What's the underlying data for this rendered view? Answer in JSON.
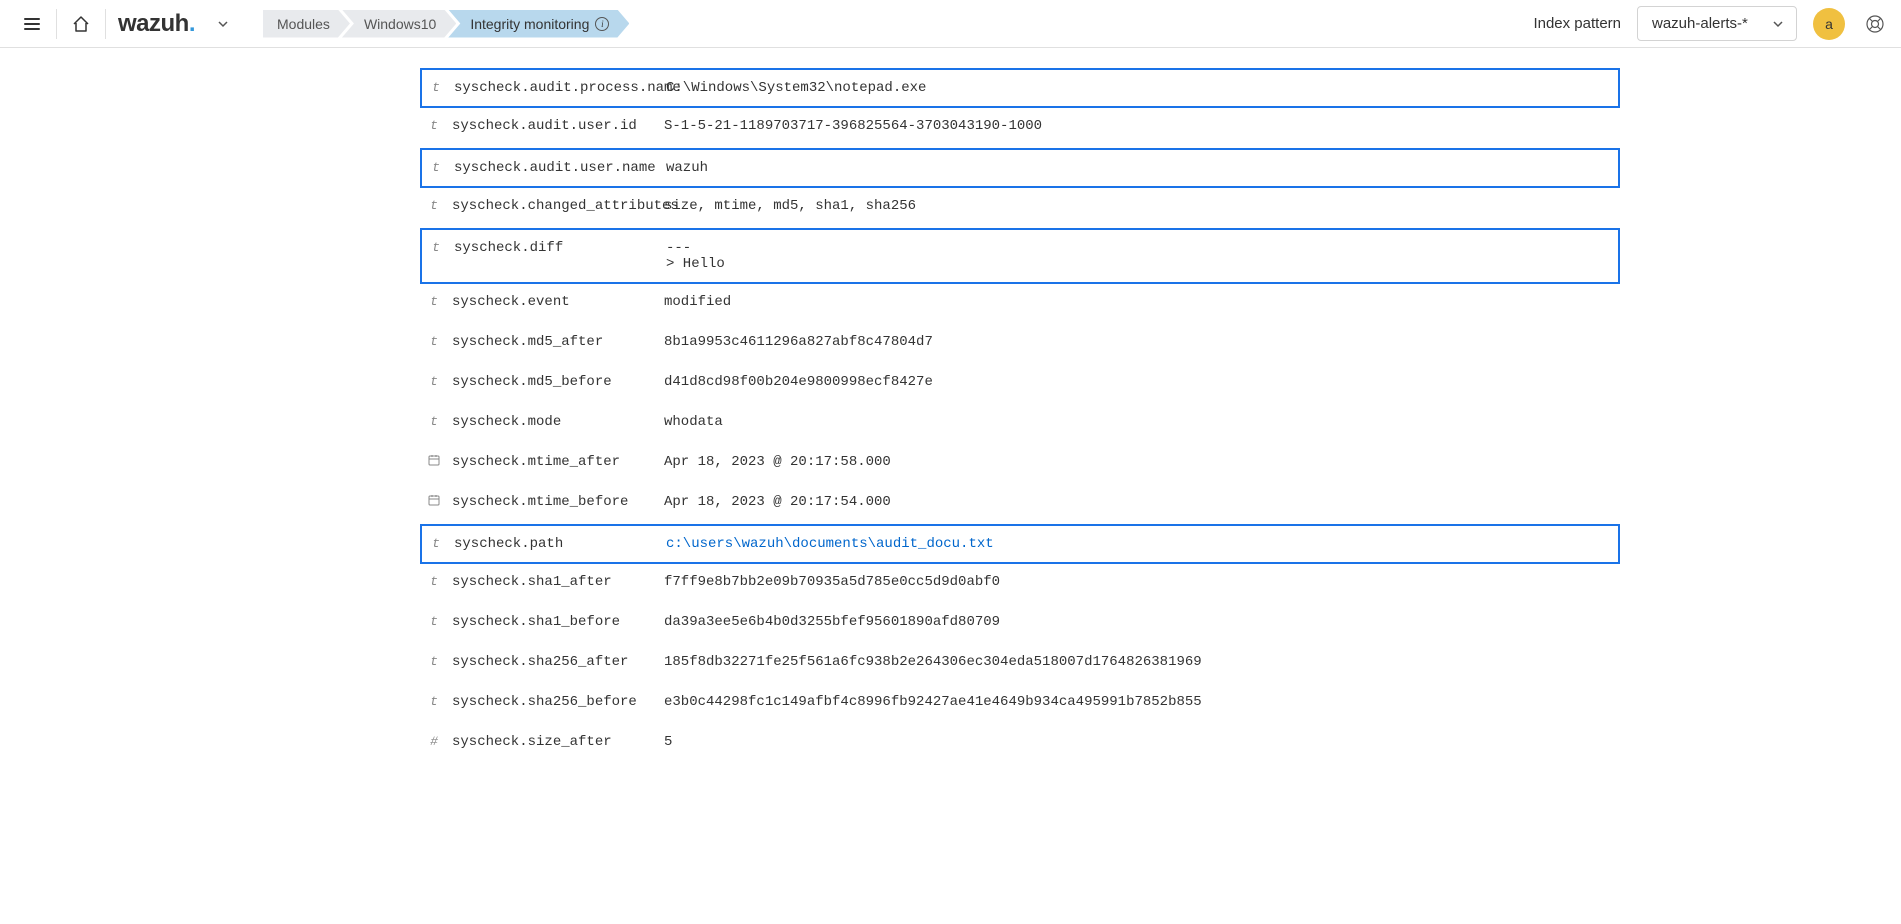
{
  "header": {
    "logo": "wazuh",
    "breadcrumbs": [
      {
        "label": "Modules"
      },
      {
        "label": "Windows10"
      },
      {
        "label": "Integrity monitoring"
      }
    ],
    "indexPatternLabel": "Index pattern",
    "indexPatternValue": "wazuh-alerts-*",
    "avatarLetter": "a"
  },
  "fields": [
    {
      "type": "t",
      "name": "syscheck.audit.process.name",
      "value": "C:\\Windows\\System32\\notepad.exe",
      "highlighted": true
    },
    {
      "type": "t",
      "name": "syscheck.audit.user.id",
      "value": "S-1-5-21-1189703717-396825564-3703043190-1000"
    },
    {
      "type": "t",
      "name": "syscheck.audit.user.name",
      "value": "wazuh",
      "highlighted": true
    },
    {
      "type": "t",
      "name": "syscheck.changed_attributes",
      "value": "size, mtime, md5, sha1, sha256"
    },
    {
      "type": "t",
      "name": "syscheck.diff",
      "value": "---\n> Hello",
      "highlighted": true
    },
    {
      "type": "t",
      "name": "syscheck.event",
      "value": "modified"
    },
    {
      "type": "t",
      "name": "syscheck.md5_after",
      "value": "8b1a9953c4611296a827abf8c47804d7"
    },
    {
      "type": "t",
      "name": "syscheck.md5_before",
      "value": "d41d8cd98f00b204e9800998ecf8427e"
    },
    {
      "type": "t",
      "name": "syscheck.mode",
      "value": "whodata"
    },
    {
      "type": "date",
      "name": "syscheck.mtime_after",
      "value": "Apr 18, 2023 @ 20:17:58.000"
    },
    {
      "type": "date",
      "name": "syscheck.mtime_before",
      "value": "Apr 18, 2023 @ 20:17:54.000"
    },
    {
      "type": "t",
      "name": "syscheck.path",
      "value": "c:\\users\\wazuh\\documents\\audit_docu.txt",
      "highlighted": true,
      "link": true
    },
    {
      "type": "t",
      "name": "syscheck.sha1_after",
      "value": "f7ff9e8b7bb2e09b70935a5d785e0cc5d9d0abf0"
    },
    {
      "type": "t",
      "name": "syscheck.sha1_before",
      "value": "da39a3ee5e6b4b0d3255bfef95601890afd80709"
    },
    {
      "type": "t",
      "name": "syscheck.sha256_after",
      "value": "185f8db32271fe25f561a6fc938b2e264306ec304eda518007d1764826381969"
    },
    {
      "type": "t",
      "name": "syscheck.sha256_before",
      "value": "e3b0c44298fc1c149afbf4c8996fb92427ae41e4649b934ca495991b7852b855"
    },
    {
      "type": "#",
      "name": "syscheck.size_after",
      "value": "5"
    }
  ]
}
